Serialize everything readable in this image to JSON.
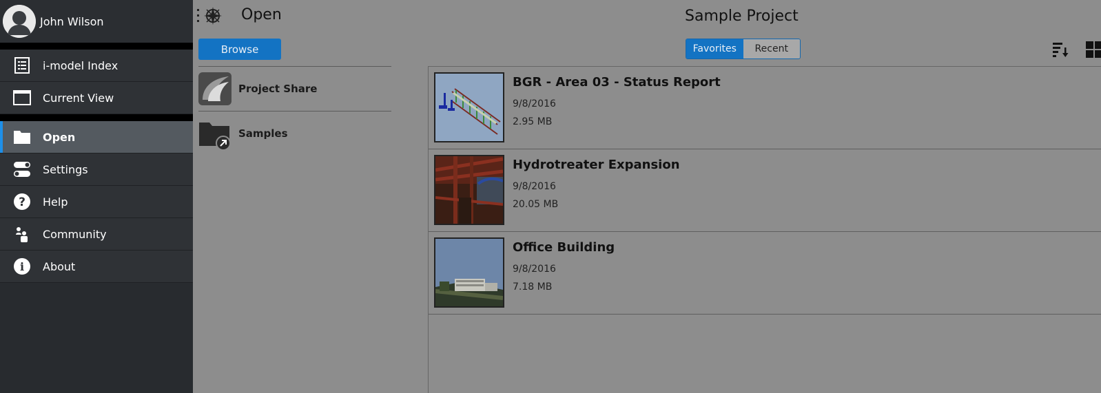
{
  "user": {
    "name": "John Wilson"
  },
  "nav": [
    {
      "label": "i-model Index",
      "icon": "index-icon"
    },
    {
      "label": "Current View",
      "icon": "window-icon"
    },
    {
      "label": "Open",
      "icon": "folder-icon",
      "active": true
    },
    {
      "label": "Settings",
      "icon": "toggle-icon"
    },
    {
      "label": "Help",
      "icon": "question-icon"
    },
    {
      "label": "Community",
      "icon": "people-icon"
    },
    {
      "label": "About",
      "icon": "info-icon"
    }
  ],
  "header": {
    "page_title": "Open",
    "project_title": "Sample Project",
    "browse_label": "Browse",
    "tabs": [
      {
        "label": "Favorites",
        "selected": true
      },
      {
        "label": "Recent",
        "selected": false
      }
    ]
  },
  "sources": [
    {
      "label": "Project Share",
      "icon": "project-share-icon"
    },
    {
      "label": "Samples",
      "icon": "samples-folder-icon"
    }
  ],
  "files": [
    {
      "name": "BGR - Area 03 - Status Report",
      "date": "9/8/2016",
      "size": "2.95 MB"
    },
    {
      "name": "Hydrotreater Expansion",
      "date": "9/8/2016",
      "size": "20.05 MB"
    },
    {
      "name": "Office Building",
      "date": "9/8/2016",
      "size": "7.18 MB"
    }
  ],
  "colors": {
    "accent": "#1373c3",
    "sidebar": "#282b2f",
    "active_item": "#545a60"
  }
}
